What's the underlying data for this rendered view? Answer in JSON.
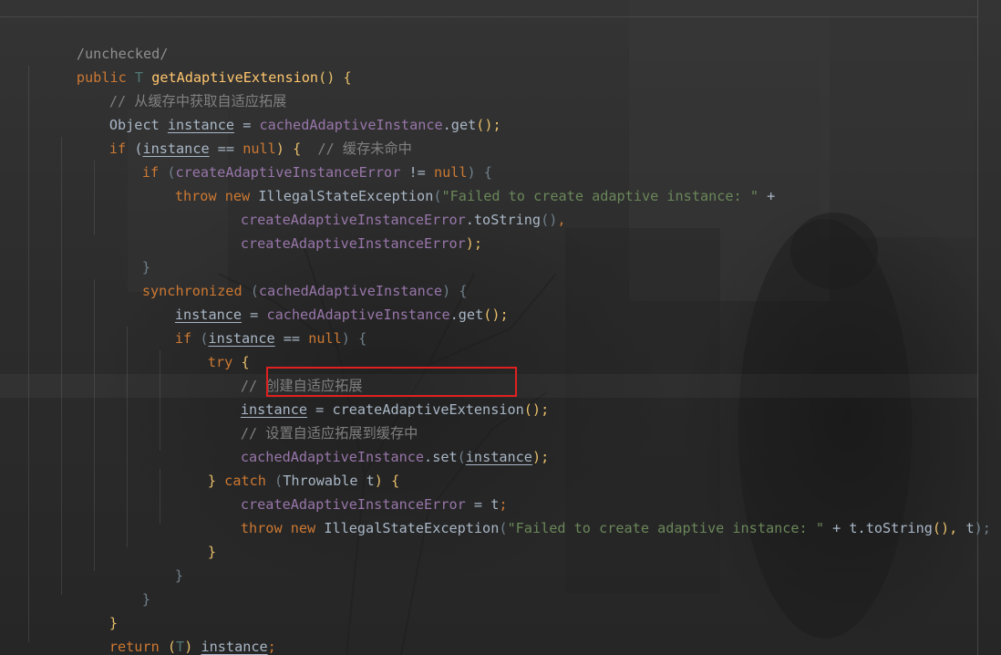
{
  "colors": {
    "keyword": "#cc7832",
    "method": "#ffc66d",
    "field": "#9876aa",
    "string": "#6a8759",
    "comment": "#808080",
    "text": "#a9b7c6",
    "highlight_box": "#e02020"
  },
  "code": {
    "l01": {
      "a": "/unchecked/"
    },
    "l02": {
      "a": "public ",
      "b": "T ",
      "c": "getAdaptiveExtension",
      "d": "() {"
    },
    "l03": {
      "a": "// 从缓存中获取自适应拓展"
    },
    "l04": {
      "a": "Object ",
      "b": "instance",
      "c": " = ",
      "d": "cachedAdaptiveInstance",
      "e": ".get",
      "f": "();"
    },
    "l05": {
      "a": "if ",
      "b": "(",
      "c": "instance",
      "d": " == ",
      "e": "null",
      "f": ") {  ",
      "g": "// 缓存未命中"
    },
    "l06": {
      "a": "if ",
      "b": "(",
      "c": "createAdaptiveInstanceError",
      "d": " != ",
      "e": "null",
      "f": ") {"
    },
    "l07": {
      "a": "throw ",
      "b": "new ",
      "c": "IllegalStateException",
      "d": "(",
      "e": "\"Failed to create adaptive instance: \"",
      "f": " +"
    },
    "l08": {
      "a": "createAdaptiveInstanceError",
      "b": ".toString",
      "c": "()",
      "d": ","
    },
    "l09": {
      "a": "createAdaptiveInstanceError",
      "b": ");"
    },
    "l10": {
      "a": "}"
    },
    "l11": {
      "a": "synchronized ",
      "b": "(",
      "c": "cachedAdaptiveInstance",
      "d": ") {"
    },
    "l12": {
      "a": "instance",
      "b": " = ",
      "c": "cachedAdaptiveInstance",
      "d": ".get",
      "e": "();"
    },
    "l13": {
      "a": "if ",
      "b": "(",
      "c": "instance",
      "d": " == ",
      "e": "null",
      "f": ") {"
    },
    "l14": {
      "a": "try ",
      "b": "{"
    },
    "l15": {
      "a": "// 创建自适应拓展"
    },
    "l16": {
      "a": "instance",
      "b": " = ",
      "c": "createAdaptiveExtension",
      "d": "();"
    },
    "l17": {
      "a": "// 设置自适应拓展到缓存中"
    },
    "l18": {
      "a": "cachedAdaptiveInstance",
      "b": ".set",
      "c": "(",
      "d": "instance",
      "e": ");"
    },
    "l19": {
      "a": "} ",
      "b": "catch ",
      "c": "(",
      "d": "Throwable ",
      "e": "t",
      "f": ") {"
    },
    "l20": {
      "a": "createAdaptiveInstanceError",
      "b": " = ",
      "c": "t",
      "d": ";"
    },
    "l21": {
      "a": "throw ",
      "b": "new ",
      "c": "IllegalStateException",
      "d": "(",
      "e": "\"Failed to create adaptive instance: \"",
      "f": " + t.",
      "g": "toString",
      "h": "(), ",
      "i": "t",
      "j": ");"
    },
    "l22": {
      "a": "}"
    },
    "l23": {
      "a": "}"
    },
    "l24": {
      "a": "}"
    },
    "l25": {
      "a": "}"
    },
    "l26": {
      "a": "return ",
      "b": "(",
      "c": "T",
      "d": ") ",
      "e": "instance",
      "f": ";"
    },
    "l27": {
      "a": "}"
    }
  }
}
